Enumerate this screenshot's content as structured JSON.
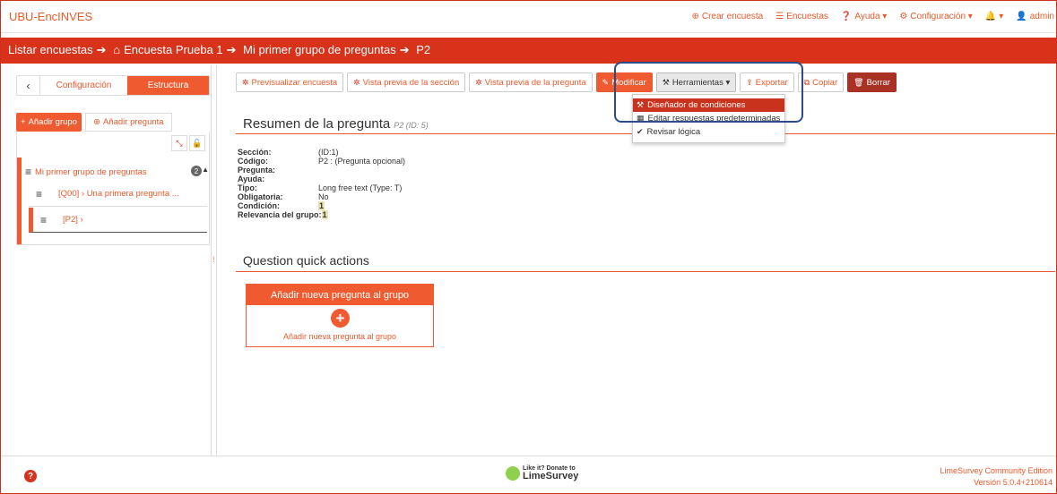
{
  "app": {
    "brand": "UBU-EncINVES"
  },
  "topnav": [
    {
      "icon": "plus-circle-icon",
      "glyph": "⊕",
      "label": "Crear encuesta"
    },
    {
      "icon": "list-icon",
      "glyph": "☰",
      "label": "Encuestas"
    },
    {
      "icon": "question-circle-icon",
      "glyph": "❓",
      "label": "Ayuda ▾"
    },
    {
      "icon": "cogs-icon",
      "glyph": "⚙",
      "label": "Configuración ▾"
    },
    {
      "icon": "bell-icon",
      "glyph": "🔔",
      "label": "▾"
    },
    {
      "icon": "user-icon",
      "glyph": "👤",
      "label": "admin"
    }
  ],
  "breadcrumb": {
    "item1": "Listar encuestas",
    "item2": "Encuesta Prueba 1",
    "item3": "Mi primer grupo de preguntas",
    "item4": "P2"
  },
  "sidebar": {
    "tab_config": "Configuración",
    "tab_structure": "Estructura",
    "add_group": "Añadir grupo",
    "add_question": "Añadir pregunta",
    "group_name": "Mi primer grupo de preguntas",
    "group_count": "2",
    "items": [
      {
        "label": "[Q00] › Una primera pregunta ..."
      },
      {
        "label": "[P2] ›"
      }
    ]
  },
  "toolbar": {
    "preview_survey": "Previsualizar encuesta",
    "preview_section": "Vista previa de la sección",
    "preview_question": "Vista previa de la pregunta",
    "modify": "Modificar",
    "tools": "Herramientas ▾",
    "export": "Exportar",
    "copy": "Copiar",
    "delete": "Borrar"
  },
  "tools_menu": [
    {
      "icon": "wand-icon",
      "glyph": "⚒",
      "label": "Diseñador de condiciones"
    },
    {
      "icon": "table-edit-icon",
      "glyph": "▦",
      "label": "Editar respuestas predeterminadas"
    },
    {
      "icon": "logic-check-icon",
      "glyph": "✔",
      "label": "Revisar lógica"
    }
  ],
  "summary": {
    "title": "Resumen de la pregunta",
    "subtitle": "P2 (ID: 5)",
    "rows": [
      {
        "key": "Sección:",
        "value": "(ID:1)"
      },
      {
        "key": "Código:",
        "value": "P2 : (Pregunta opcional)"
      },
      {
        "key": "Pregunta:",
        "value": ""
      },
      {
        "key": "Ayuda:",
        "value": ""
      },
      {
        "key": "Tipo:",
        "value": "Long free text (Type: T)"
      },
      {
        "key": "Obligatoria:",
        "value": "No"
      },
      {
        "key": "Condición:",
        "value": "1"
      },
      {
        "key": "Relevancia del grupo:",
        "value": "1"
      }
    ]
  },
  "quick_actions": {
    "title": "Question quick actions",
    "card_header": "Añadir nueva pregunta al grupo",
    "card_label": "Añadir nueva pregunta al grupo"
  },
  "footer": {
    "donate_top": "Like it? Donate to",
    "donate_brand": "LimeSurvey",
    "edition": "LimeSurvey Community Edition",
    "version": "Versión 5.0.4+210614"
  },
  "colors": {
    "accent": "#f05a30",
    "brand_red": "#d9321b",
    "highlight": "#2c4c8c"
  }
}
